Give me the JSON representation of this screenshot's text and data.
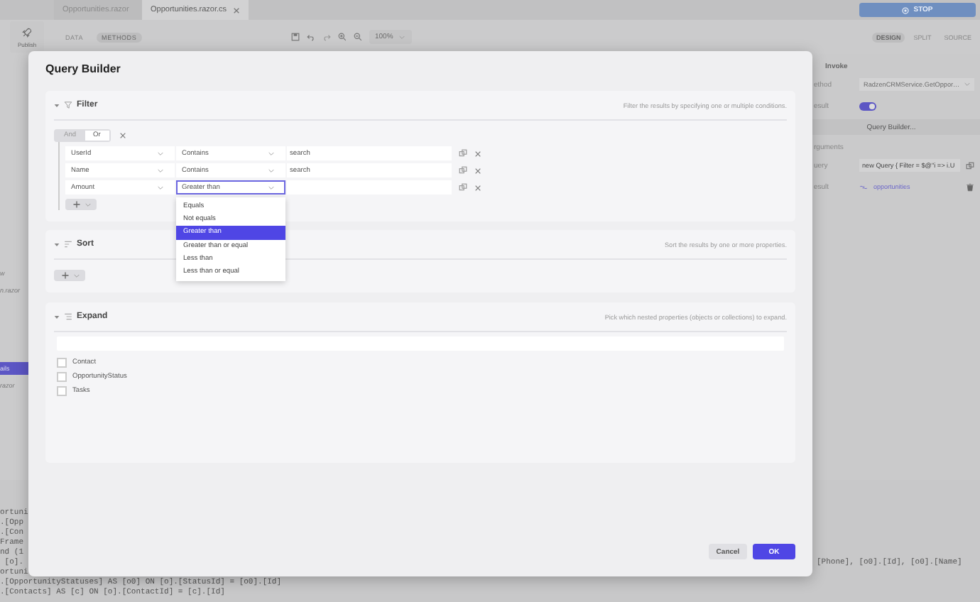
{
  "background": {
    "tabs": [
      {
        "label": "Opportunities.razor",
        "selected": false,
        "closable": false
      },
      {
        "label": "Opportunities.razor.cs",
        "selected": true,
        "closable": true
      }
    ],
    "stop_button": "STOP",
    "publish_button": "Publish",
    "mode_tabs": [
      {
        "label": "DATA",
        "selected": false
      },
      {
        "label": "METHODS",
        "selected": true
      }
    ],
    "zoom": "100%",
    "view_tabs": [
      {
        "label": "DESIGN",
        "selected": true
      },
      {
        "label": "SPLIT",
        "selected": false
      },
      {
        "label": "SOURCE",
        "selected": false
      }
    ],
    "sidebar_items": [
      {
        "text": "w",
        "selected": false
      },
      {
        "text": "n.razor",
        "selected": false
      },
      {
        "text": "ails",
        "selected": true
      },
      {
        "text": "razor",
        "selected": false
      }
    ],
    "properties": {
      "title": "Invoke",
      "rows": [
        {
          "kind": "select",
          "label": "ethod",
          "value": "RadzenCRMService.GetOppor…"
        },
        {
          "kind": "toggle",
          "label": "esult",
          "on": true
        },
        {
          "kind": "button",
          "text": "Query Builder..."
        },
        {
          "kind": "heading",
          "text": "rguments"
        },
        {
          "kind": "input",
          "label": "uery",
          "value": "new Query { Filter = $@\"i => i.U"
        },
        {
          "kind": "link",
          "label": "esult",
          "value": "opportunities"
        }
      ]
    },
    "code_lines": [
      {
        "text": "ortuni"
      },
      {
        "text": ".[Opp"
      },
      {
        "text": ".[Con"
      },
      {
        "text": "Frame"
      },
      {
        "text": "nd (1"
      },
      {
        "text": " [o].",
        "tail": "[Phone], [o0].[Id], [o0].[Name]"
      },
      {
        "text": "ortuni"
      },
      {
        "text": ".[OpportunityStatuses] AS [o0] ON [o].[StatusId] = [o0].[Id]"
      },
      {
        "text": ".[Contacts] AS [c] ON [o].[ContactId] = [c].[Id]"
      }
    ]
  },
  "dialog": {
    "title": "Query Builder",
    "filter": {
      "title": "Filter",
      "description": "Filter the results by specifying one or multiple conditions.",
      "logic": [
        {
          "label": "And",
          "selected": false
        },
        {
          "label": "Or",
          "selected": true
        }
      ],
      "rows": [
        {
          "field": "UserId",
          "operator": "Contains",
          "value": "search",
          "expanded": false
        },
        {
          "field": "Name",
          "operator": "Contains",
          "value": "search",
          "expanded": false
        },
        {
          "field": "Amount",
          "operator": "Greater than",
          "expanded": true
        }
      ],
      "operator_options": [
        {
          "label": "Equals",
          "selected": false
        },
        {
          "label": "Not equals",
          "selected": false
        },
        {
          "label": "Greater than",
          "selected": true
        },
        {
          "label": "Greater than or equal",
          "selected": false
        },
        {
          "label": "Less than",
          "selected": false
        },
        {
          "label": "Less than or equal",
          "selected": false
        }
      ]
    },
    "sort": {
      "title": "Sort",
      "description": "Sort the results by one or more properties."
    },
    "expand": {
      "title": "Expand",
      "description": "Pick which nested properties (objects or collections) to expand.",
      "items": [
        {
          "label": "Contact",
          "checked": false
        },
        {
          "label": "OpportunityStatus",
          "checked": false
        },
        {
          "label": "Tasks",
          "checked": false
        }
      ]
    },
    "buttons": [
      {
        "label": "Cancel",
        "kind": "secondary"
      },
      {
        "label": "OK",
        "kind": "primary"
      }
    ]
  }
}
